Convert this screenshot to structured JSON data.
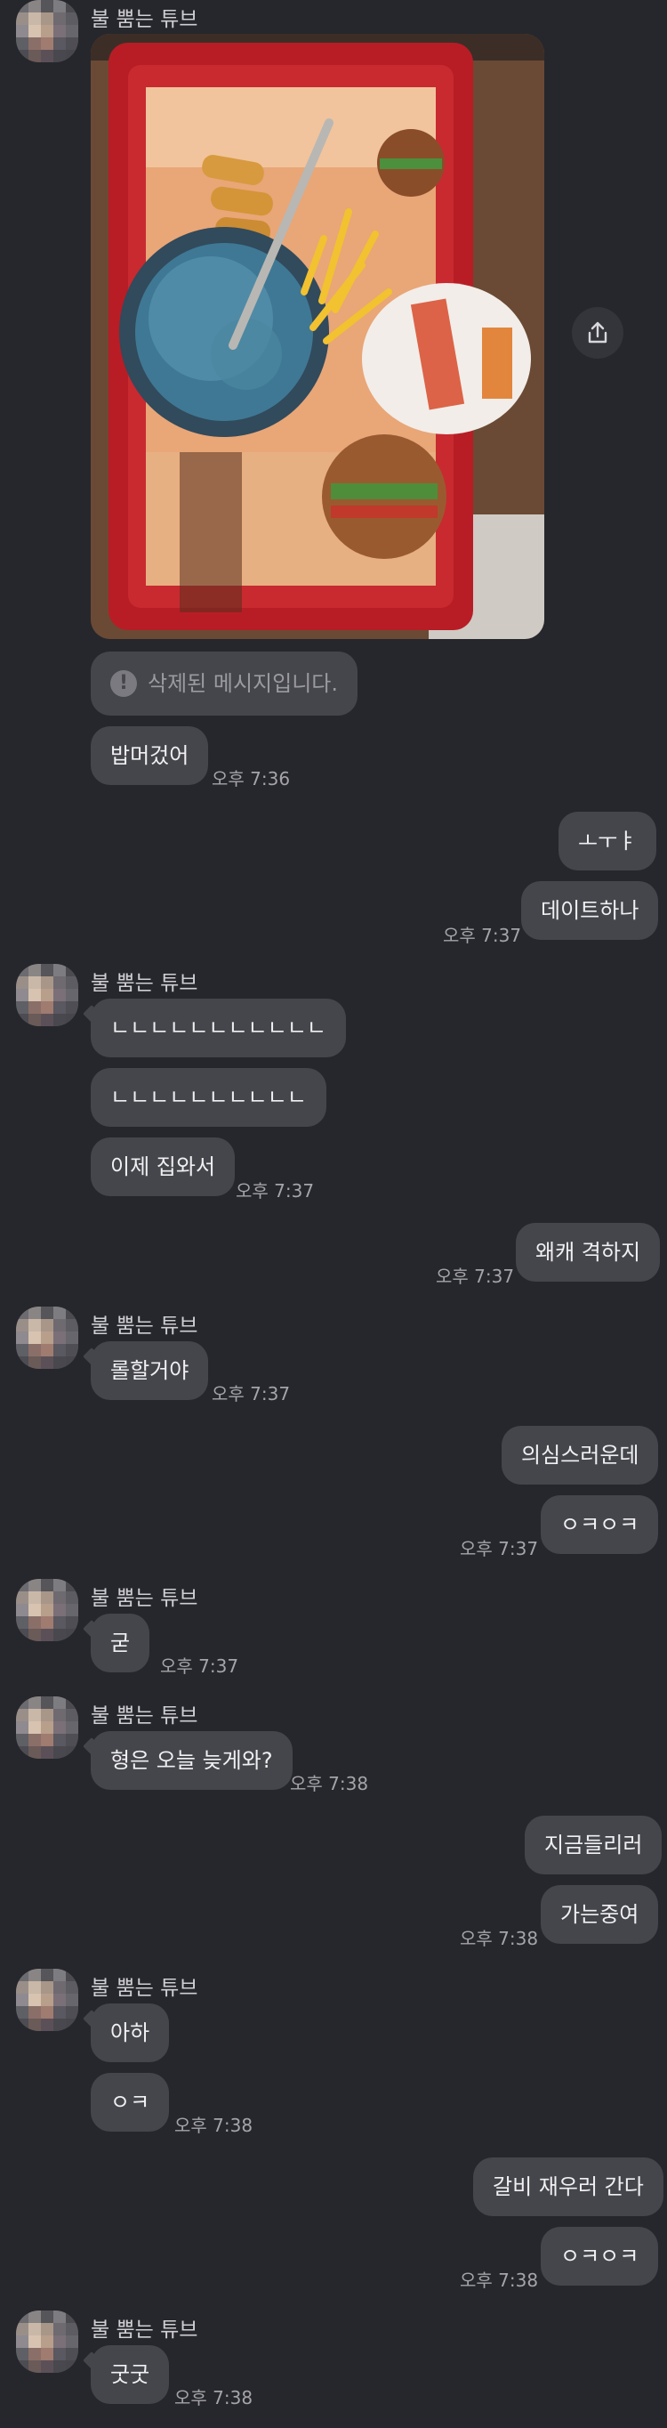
{
  "sender_name": "불 뿜는 튜브",
  "share_label": "share",
  "messages": {
    "deleted": "삭제된 메시지입니다.",
    "m1": "밥머겄어",
    "m1_time": "오후 7:36",
    "r1": "ㅗㅜㅑ",
    "r2": "데이트하나",
    "r2_time": "오후 7:37",
    "m2": "ㄴㄴㄴㄴㄴㄴㄴㄴㄴㄴㄴ",
    "m3": "ㄴㄴㄴㄴㄴㄴㄴㄴㄴㄴ",
    "m4": "이제 집와서",
    "m4_time": "오후 7:37",
    "r3": "왜캐 격하지",
    "r3_time": "오후 7:37",
    "m5": "롤할거야",
    "m5_time": "오후 7:37",
    "r4": "의심스러운데",
    "r5": "ㅇㅋㅇㅋ",
    "r5_time": "오후 7:37",
    "m6": "굳",
    "m6_time": "오후 7:37",
    "m7": "형은 오늘 늦게와?",
    "m7_time": "오후 7:38",
    "r6": "지금들리러",
    "r7": "가는중여",
    "r7_time": "오후 7:38",
    "m8": "아하",
    "m9": "ㅇㅋ",
    "m9_time": "오후 7:38",
    "r8": "갈비 재우러 간다",
    "r9": "ㅇㅋㅇㅋ",
    "r9_time": "오후 7:38",
    "m10": "굿굿",
    "m10_time": "오후 7:38"
  },
  "colors": {
    "background": "#26272c",
    "bubble": "#45464c",
    "text": "#f0f0f2",
    "timestamp": "#a4a4a9"
  }
}
